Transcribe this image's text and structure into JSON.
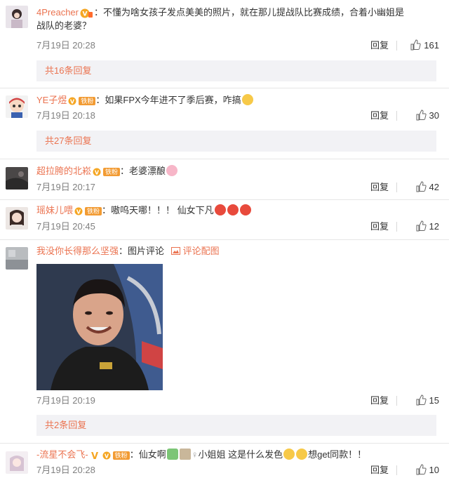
{
  "comments": [
    {
      "username": "4Preacher",
      "text_line1": "不懂为啥女孩子发点美美的照片，就在那儿提战队比赛成绩，合着小幽姐是",
      "text_line2": "战队的老婆？",
      "time": "7月19日 20:28",
      "reply_label": "回复",
      "likes": "161",
      "more_replies": "共16条回复"
    },
    {
      "username": "YE子煜",
      "fan_badge": "铁粉",
      "text": "如果FPX今年进不了季后赛，咋搞",
      "time": "7月19日 20:18",
      "reply_label": "回复",
      "likes": "30",
      "more_replies": "共27条回复"
    },
    {
      "username": "超拉胯的北崧",
      "fan_badge": "铁粉",
      "text": "老婆漂酿",
      "time": "7月19日 20:17",
      "reply_label": "回复",
      "likes": "42"
    },
    {
      "username": "瑶妹儿喂",
      "fan_badge": "铁粉",
      "text": "嗷呜天哪！！！ 仙女下凡",
      "time": "7月19日 20:45",
      "reply_label": "回复",
      "likes": "12"
    },
    {
      "username": "我没你长得那么坚强",
      "text": "图片评论",
      "image_link": "评论配图",
      "time": "7月19日 20:19",
      "reply_label": "回复",
      "likes": "15",
      "more_replies": "共2条回复"
    },
    {
      "username": "-流星不会飞-",
      "fan_badge": "铁粉",
      "text_a": "仙女啊",
      "text_b": "小姐姐 这是什么发色",
      "text_c": "想get同款！！",
      "time": "7月19日 20:28",
      "reply_label": "回复",
      "likes": "10"
    }
  ],
  "colors": {
    "username": "#eb7350",
    "fan_badge": "#f29b33",
    "more_bg": "#f2f2f5"
  }
}
